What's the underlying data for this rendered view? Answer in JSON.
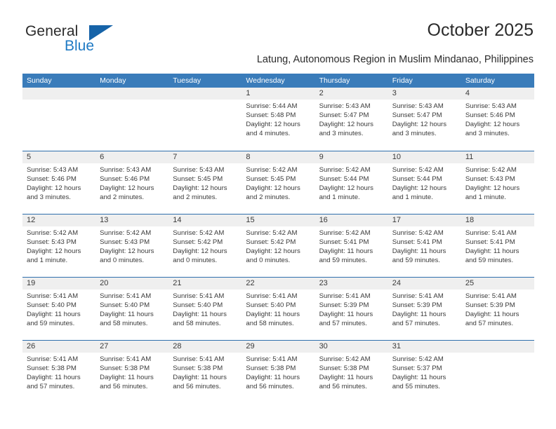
{
  "brand": {
    "name_part1": "General",
    "name_part2": "Blue",
    "triangle_color": "#1663a8",
    "blue_color": "#1f7ac4"
  },
  "header": {
    "title": "October 2025",
    "subtitle": "Latung, Autonomous Region in Muslim Mindanao, Philippines"
  },
  "theme": {
    "header_bg": "#3a7cba",
    "row_divider": "#2f6fad",
    "daynum_bg": "#efefef",
    "text": "#3a3a3a"
  },
  "calendar": {
    "weekday_headers": [
      "Sunday",
      "Monday",
      "Tuesday",
      "Wednesday",
      "Thursday",
      "Friday",
      "Saturday"
    ],
    "weeks": [
      [
        {
          "day": "",
          "lines": []
        },
        {
          "day": "",
          "lines": []
        },
        {
          "day": "",
          "lines": []
        },
        {
          "day": "1",
          "lines": [
            "Sunrise: 5:44 AM",
            "Sunset: 5:48 PM",
            "Daylight: 12 hours",
            "and 4 minutes."
          ]
        },
        {
          "day": "2",
          "lines": [
            "Sunrise: 5:43 AM",
            "Sunset: 5:47 PM",
            "Daylight: 12 hours",
            "and 3 minutes."
          ]
        },
        {
          "day": "3",
          "lines": [
            "Sunrise: 5:43 AM",
            "Sunset: 5:47 PM",
            "Daylight: 12 hours",
            "and 3 minutes."
          ]
        },
        {
          "day": "4",
          "lines": [
            "Sunrise: 5:43 AM",
            "Sunset: 5:46 PM",
            "Daylight: 12 hours",
            "and 3 minutes."
          ]
        }
      ],
      [
        {
          "day": "5",
          "lines": [
            "Sunrise: 5:43 AM",
            "Sunset: 5:46 PM",
            "Daylight: 12 hours",
            "and 3 minutes."
          ]
        },
        {
          "day": "6",
          "lines": [
            "Sunrise: 5:43 AM",
            "Sunset: 5:46 PM",
            "Daylight: 12 hours",
            "and 2 minutes."
          ]
        },
        {
          "day": "7",
          "lines": [
            "Sunrise: 5:43 AM",
            "Sunset: 5:45 PM",
            "Daylight: 12 hours",
            "and 2 minutes."
          ]
        },
        {
          "day": "8",
          "lines": [
            "Sunrise: 5:42 AM",
            "Sunset: 5:45 PM",
            "Daylight: 12 hours",
            "and 2 minutes."
          ]
        },
        {
          "day": "9",
          "lines": [
            "Sunrise: 5:42 AM",
            "Sunset: 5:44 PM",
            "Daylight: 12 hours",
            "and 1 minute."
          ]
        },
        {
          "day": "10",
          "lines": [
            "Sunrise: 5:42 AM",
            "Sunset: 5:44 PM",
            "Daylight: 12 hours",
            "and 1 minute."
          ]
        },
        {
          "day": "11",
          "lines": [
            "Sunrise: 5:42 AM",
            "Sunset: 5:43 PM",
            "Daylight: 12 hours",
            "and 1 minute."
          ]
        }
      ],
      [
        {
          "day": "12",
          "lines": [
            "Sunrise: 5:42 AM",
            "Sunset: 5:43 PM",
            "Daylight: 12 hours",
            "and 1 minute."
          ]
        },
        {
          "day": "13",
          "lines": [
            "Sunrise: 5:42 AM",
            "Sunset: 5:43 PM",
            "Daylight: 12 hours",
            "and 0 minutes."
          ]
        },
        {
          "day": "14",
          "lines": [
            "Sunrise: 5:42 AM",
            "Sunset: 5:42 PM",
            "Daylight: 12 hours",
            "and 0 minutes."
          ]
        },
        {
          "day": "15",
          "lines": [
            "Sunrise: 5:42 AM",
            "Sunset: 5:42 PM",
            "Daylight: 12 hours",
            "and 0 minutes."
          ]
        },
        {
          "day": "16",
          "lines": [
            "Sunrise: 5:42 AM",
            "Sunset: 5:41 PM",
            "Daylight: 11 hours",
            "and 59 minutes."
          ]
        },
        {
          "day": "17",
          "lines": [
            "Sunrise: 5:42 AM",
            "Sunset: 5:41 PM",
            "Daylight: 11 hours",
            "and 59 minutes."
          ]
        },
        {
          "day": "18",
          "lines": [
            "Sunrise: 5:41 AM",
            "Sunset: 5:41 PM",
            "Daylight: 11 hours",
            "and 59 minutes."
          ]
        }
      ],
      [
        {
          "day": "19",
          "lines": [
            "Sunrise: 5:41 AM",
            "Sunset: 5:40 PM",
            "Daylight: 11 hours",
            "and 59 minutes."
          ]
        },
        {
          "day": "20",
          "lines": [
            "Sunrise: 5:41 AM",
            "Sunset: 5:40 PM",
            "Daylight: 11 hours",
            "and 58 minutes."
          ]
        },
        {
          "day": "21",
          "lines": [
            "Sunrise: 5:41 AM",
            "Sunset: 5:40 PM",
            "Daylight: 11 hours",
            "and 58 minutes."
          ]
        },
        {
          "day": "22",
          "lines": [
            "Sunrise: 5:41 AM",
            "Sunset: 5:40 PM",
            "Daylight: 11 hours",
            "and 58 minutes."
          ]
        },
        {
          "day": "23",
          "lines": [
            "Sunrise: 5:41 AM",
            "Sunset: 5:39 PM",
            "Daylight: 11 hours",
            "and 57 minutes."
          ]
        },
        {
          "day": "24",
          "lines": [
            "Sunrise: 5:41 AM",
            "Sunset: 5:39 PM",
            "Daylight: 11 hours",
            "and 57 minutes."
          ]
        },
        {
          "day": "25",
          "lines": [
            "Sunrise: 5:41 AM",
            "Sunset: 5:39 PM",
            "Daylight: 11 hours",
            "and 57 minutes."
          ]
        }
      ],
      [
        {
          "day": "26",
          "lines": [
            "Sunrise: 5:41 AM",
            "Sunset: 5:38 PM",
            "Daylight: 11 hours",
            "and 57 minutes."
          ]
        },
        {
          "day": "27",
          "lines": [
            "Sunrise: 5:41 AM",
            "Sunset: 5:38 PM",
            "Daylight: 11 hours",
            "and 56 minutes."
          ]
        },
        {
          "day": "28",
          "lines": [
            "Sunrise: 5:41 AM",
            "Sunset: 5:38 PM",
            "Daylight: 11 hours",
            "and 56 minutes."
          ]
        },
        {
          "day": "29",
          "lines": [
            "Sunrise: 5:41 AM",
            "Sunset: 5:38 PM",
            "Daylight: 11 hours",
            "and 56 minutes."
          ]
        },
        {
          "day": "30",
          "lines": [
            "Sunrise: 5:42 AM",
            "Sunset: 5:38 PM",
            "Daylight: 11 hours",
            "and 56 minutes."
          ]
        },
        {
          "day": "31",
          "lines": [
            "Sunrise: 5:42 AM",
            "Sunset: 5:37 PM",
            "Daylight: 11 hours",
            "and 55 minutes."
          ]
        },
        {
          "day": "",
          "lines": []
        }
      ]
    ]
  }
}
